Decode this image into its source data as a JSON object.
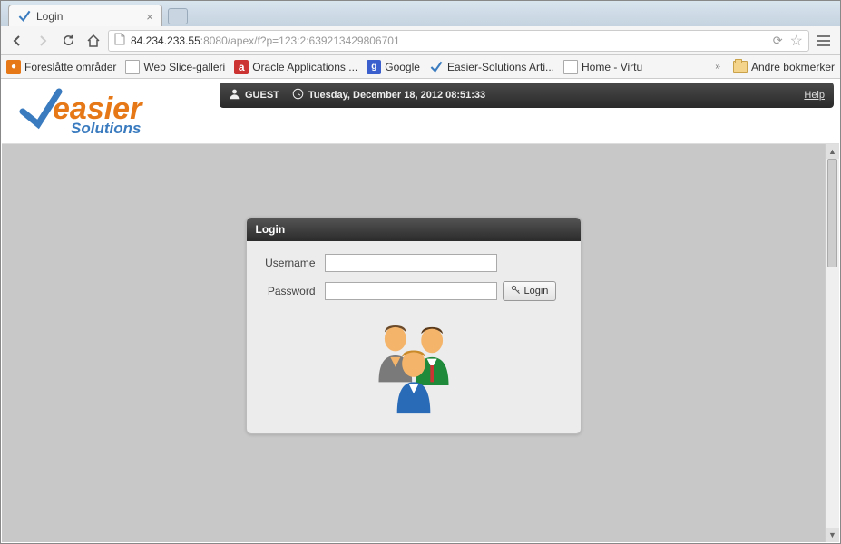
{
  "window": {
    "title": "Login"
  },
  "browser": {
    "tab_title": "Login",
    "url_host": "84.234.233.55",
    "url_rest": ":8080/apex/f?p=123:2:639213429806701"
  },
  "bookmarks": {
    "items": [
      {
        "label": "Foreslåtte områder"
      },
      {
        "label": "Web Slice-galleri"
      },
      {
        "label": "Oracle Applications ..."
      },
      {
        "label": "Google"
      },
      {
        "label": "Easier-Solutions Arti..."
      },
      {
        "label": "Home - Virtu"
      }
    ],
    "overflow_label": "»",
    "other_folder": "Andre bokmerker"
  },
  "app": {
    "logo_top": "easier",
    "logo_bottom": "Solutions",
    "user_label": "GUEST",
    "datetime": "Tuesday, December 18, 2012 08:51:33",
    "help_label": "Help"
  },
  "login": {
    "card_title": "Login",
    "username_label": "Username",
    "password_label": "Password",
    "username_value": "",
    "password_value": "",
    "button_label": "Login"
  }
}
